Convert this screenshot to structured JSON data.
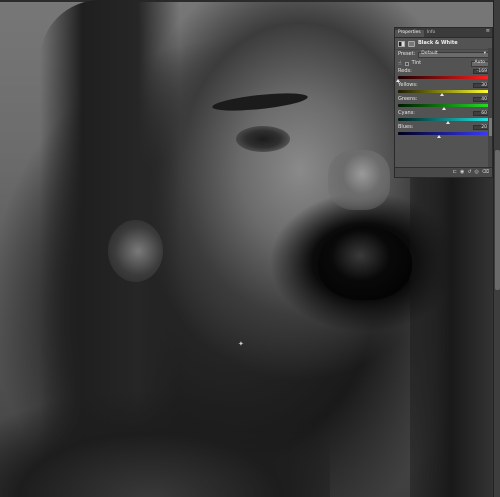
{
  "panel": {
    "tabs": [
      {
        "label": "Properties",
        "active": true
      },
      {
        "label": "Info",
        "active": false
      }
    ],
    "menu_icon": "panel-menu-icon",
    "adjustment_title": "Black & White",
    "preset_label": "Preset:",
    "preset_value": "Default",
    "tint_label": "Tint",
    "auto_label": "Auto",
    "sliders": [
      {
        "key": "reds",
        "label": "Reds:",
        "value": "-169",
        "level": 0.0,
        "track": "linear-gradient(90deg,#1a0000,#ff1e1e)"
      },
      {
        "key": "yellows",
        "label": "Yellows:",
        "value": "30",
        "level": 0.48,
        "track": "linear-gradient(90deg,#1a1a00,#ffff2a)"
      },
      {
        "key": "greens",
        "label": "Greens:",
        "value": "40",
        "level": 0.5,
        "track": "linear-gradient(90deg,#001a00,#22e022)"
      },
      {
        "key": "cyans",
        "label": "Cyans:",
        "value": "60",
        "level": 0.55,
        "track": "linear-gradient(90deg,#001a1a,#20e6e6)"
      },
      {
        "key": "blues",
        "label": "Blues:",
        "value": "20",
        "level": 0.45,
        "track": "linear-gradient(90deg,#00001a,#3a3aff)"
      }
    ],
    "footer_icons": [
      "clip-to-layer-icon",
      "eye-icon",
      "reset-icon",
      "visibility-icon",
      "delete-icon"
    ]
  }
}
